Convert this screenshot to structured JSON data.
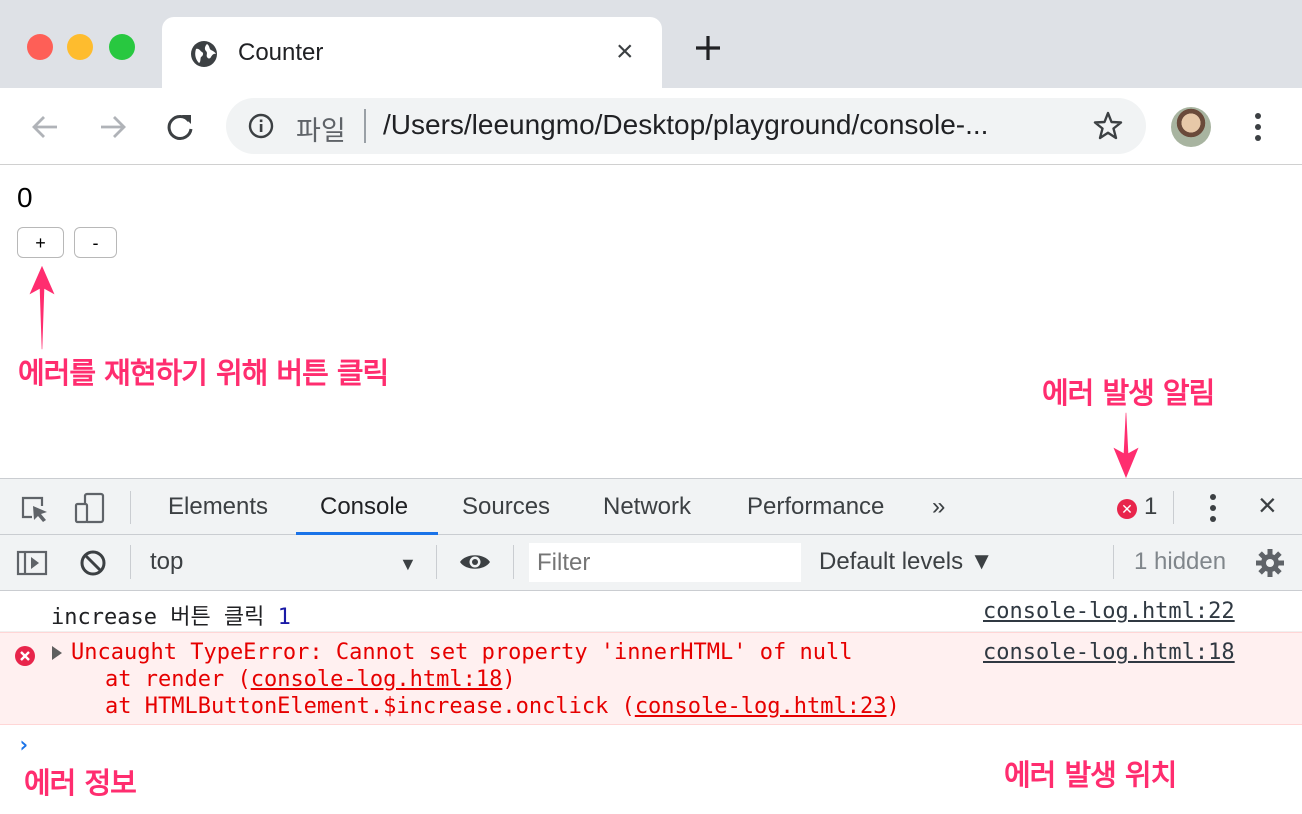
{
  "browser": {
    "tab_title": "Counter",
    "tab_close": "×",
    "omnibox_site_label": "파일",
    "url": "/Users/leeungmo/Desktop/playground/console-..."
  },
  "page": {
    "count": "0",
    "increment_label": "+",
    "decrement_label": "-"
  },
  "annotations": {
    "button_click": "에러를 재현하기 위해 버튼 클릭",
    "error_alert": "에러 발생 알림",
    "error_info": "에러 정보",
    "error_location": "에러 발생 위치"
  },
  "devtools": {
    "tabs": [
      "Elements",
      "Console",
      "Sources",
      "Network",
      "Performance"
    ],
    "active_tab": "Console",
    "more_tabs": "»",
    "error_count": "1",
    "close": "×",
    "context": "top",
    "filter_placeholder": "Filter",
    "levels": "Default levels ▼",
    "hidden": "1 hidden"
  },
  "console": {
    "log": {
      "text": "increase 버튼 클릭",
      "value": "1",
      "source": "console-log.html:22"
    },
    "error": {
      "message": "Uncaught TypeError: Cannot set property 'innerHTML' of null",
      "source": "console-log.html:18",
      "stack1_prefix": "at render (",
      "stack1_link": "console-log.html:18",
      "stack1_suffix": ")",
      "stack2_prefix": "at HTMLButtonElement.$increase.onclick (",
      "stack2_link": "console-log.html:23",
      "stack2_suffix": ")"
    },
    "prompt": "›"
  },
  "colors": {
    "annotation": "#ff2d6f",
    "error_text": "#e60000",
    "error_bg": "#fff0f0",
    "accent": "#1a73e8"
  }
}
